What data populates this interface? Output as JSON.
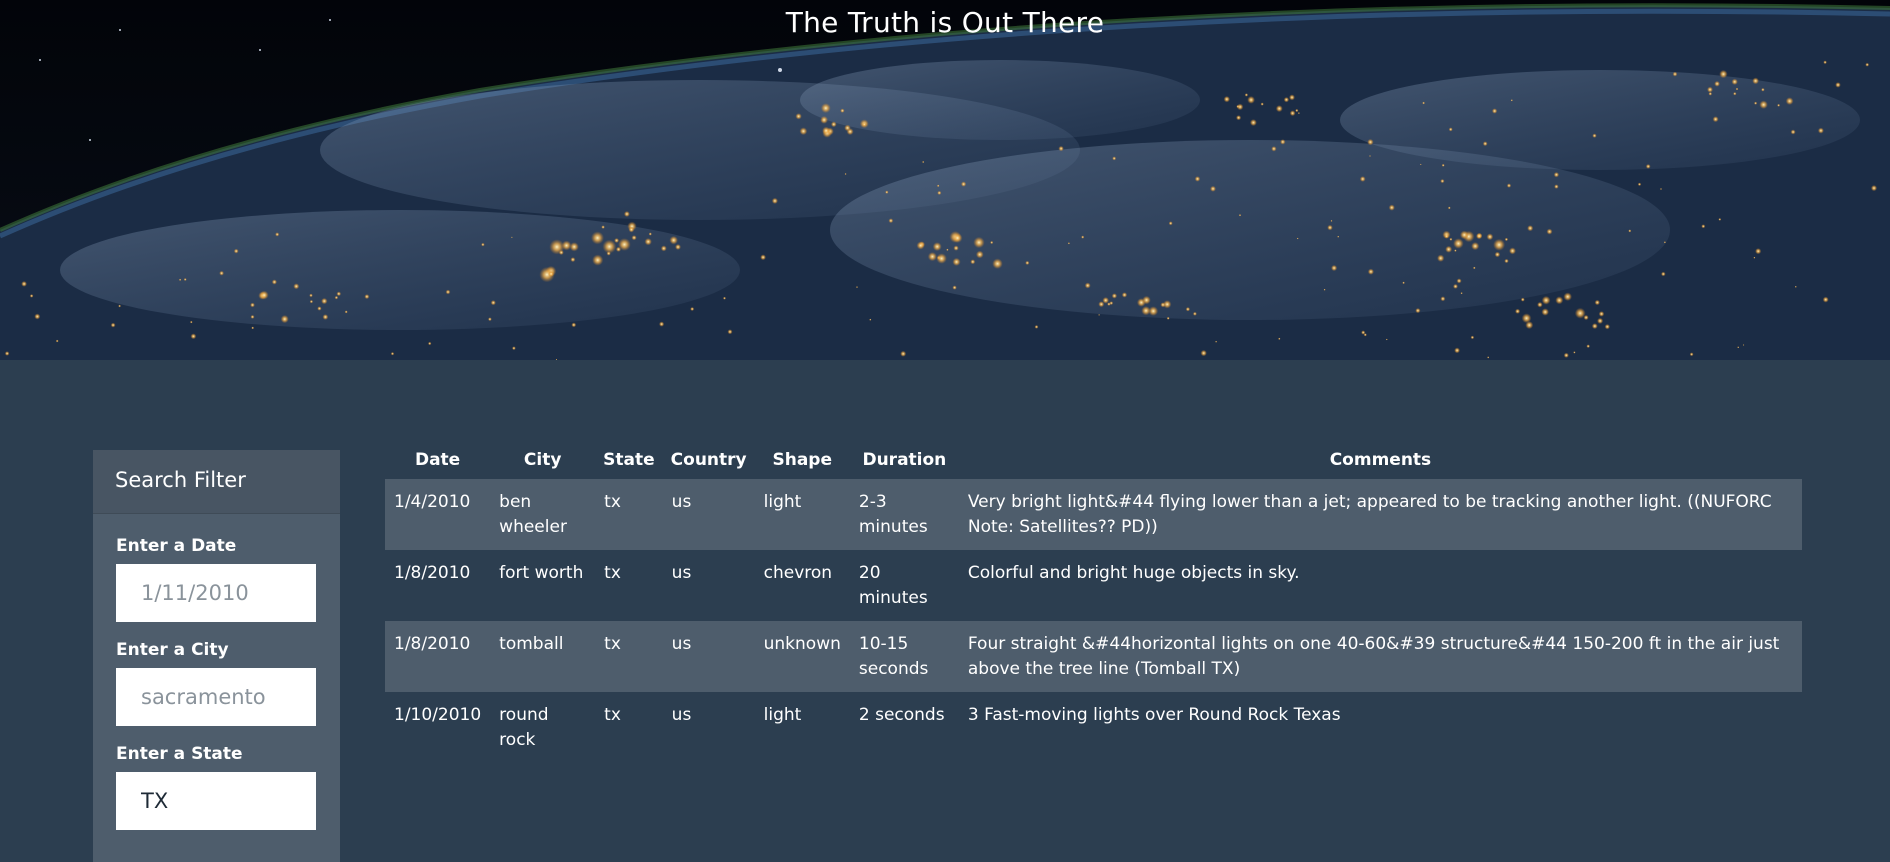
{
  "hero": {
    "title": "The Truth is Out There"
  },
  "filter": {
    "header": "Search Filter",
    "fields": [
      {
        "label": "Enter a Date",
        "value": "",
        "placeholder": "1/11/2010"
      },
      {
        "label": "Enter a City",
        "value": "",
        "placeholder": "sacramento"
      },
      {
        "label": "Enter a State",
        "value": "TX",
        "placeholder": ""
      }
    ]
  },
  "table": {
    "columns": [
      "Date",
      "City",
      "State",
      "Country",
      "Shape",
      "Duration",
      "Comments"
    ],
    "rows": [
      {
        "date": "1/4/2010",
        "city": "ben wheeler",
        "state": "tx",
        "country": "us",
        "shape": "light",
        "duration": "2-3 minutes",
        "comments": "Very bright light&#44 flying lower than a jet; appeared to be tracking another light. ((NUFORC Note: Satellites?? PD))"
      },
      {
        "date": "1/8/2010",
        "city": "fort worth",
        "state": "tx",
        "country": "us",
        "shape": "chevron",
        "duration": "20 minutes",
        "comments": "Colorful and bright huge objects in sky."
      },
      {
        "date": "1/8/2010",
        "city": "tomball",
        "state": "tx",
        "country": "us",
        "shape": "unknown",
        "duration": "10-15 seconds",
        "comments": "Four straight &#44horizontal lights on one 40-60&#39 structure&#44 150-200 ft in the air just above the tree line (Tomball TX)"
      },
      {
        "date": "1/10/2010",
        "city": "round rock",
        "state": "tx",
        "country": "us",
        "shape": "light",
        "duration": "2 seconds",
        "comments": "3 Fast-moving lights over Round Rock Texas"
      }
    ]
  },
  "colors": {
    "page_background": "#2c3e50",
    "panel_background": "#4e5d6c",
    "striped_row": "#4e5d6c",
    "text": "#ffffff"
  }
}
